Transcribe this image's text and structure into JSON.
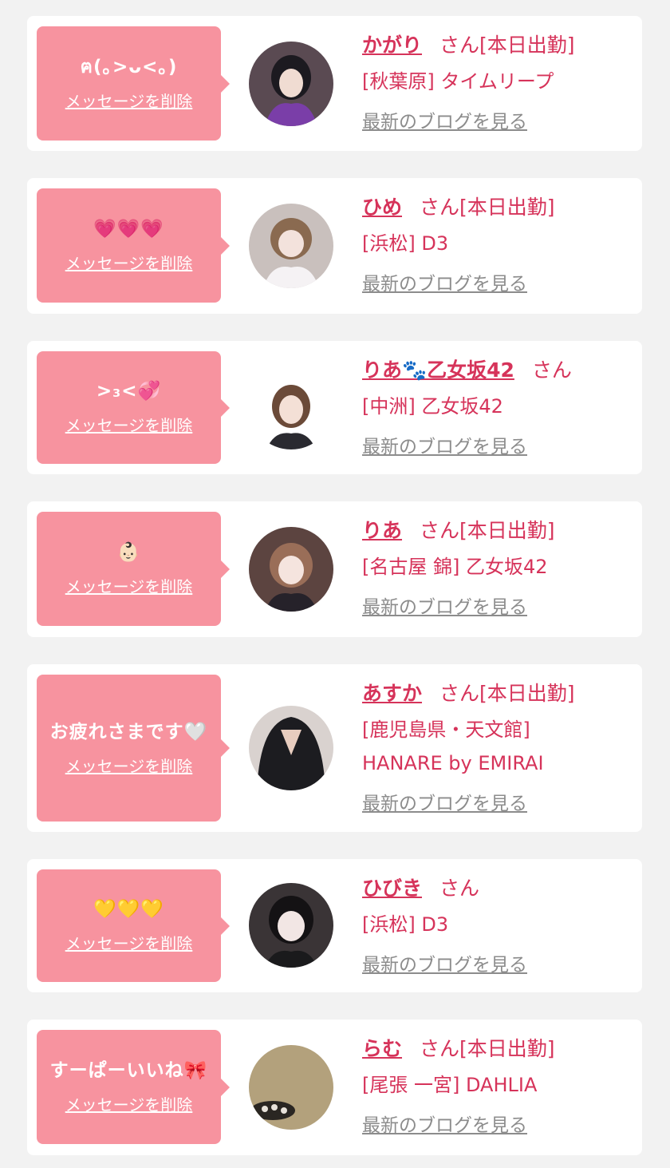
{
  "delete_label": "メッセージを削除",
  "blog_label": "最新のブログを見る",
  "colors": {
    "bubble": "#f7939f",
    "accent": "#d6335a",
    "link_gray": "#8c8c8c",
    "background": "#f2f2f2"
  },
  "items": [
    {
      "message": "ฅ(｡>ᴗ<｡)",
      "name": "かがり",
      "san": "さん",
      "status": "[本日出勤]",
      "shop": "[秋葉原] タイムリープ"
    },
    {
      "message": "💗💗💗",
      "name": "ひめ",
      "san": "さん",
      "status": "[本日出勤]",
      "shop": "[浜松] D3"
    },
    {
      "message": ">₃<💞",
      "name": "りあ🐾乙女坂42",
      "san": "さん",
      "status": "",
      "shop": "[中洲] 乙女坂42"
    },
    {
      "message": "👶🏻",
      "name": "りあ",
      "san": "さん",
      "status": "[本日出勤]",
      "shop": "[名古屋 錦] 乙女坂42"
    },
    {
      "message": "お疲れさまです🤍",
      "name": "あすか",
      "san": "さん",
      "status": "[本日出勤]",
      "shop": "[鹿児島県・天文館] HANARE by EMIRAI"
    },
    {
      "message": "💛💛💛",
      "name": "ひびき",
      "san": "さん",
      "status": "",
      "shop": "[浜松] D3"
    },
    {
      "message": "すーぱーいいね🎀",
      "name": "らむ",
      "san": "さん",
      "status": "[本日出勤]",
      "shop": "[尾張 一宮] DAHLIA"
    }
  ]
}
